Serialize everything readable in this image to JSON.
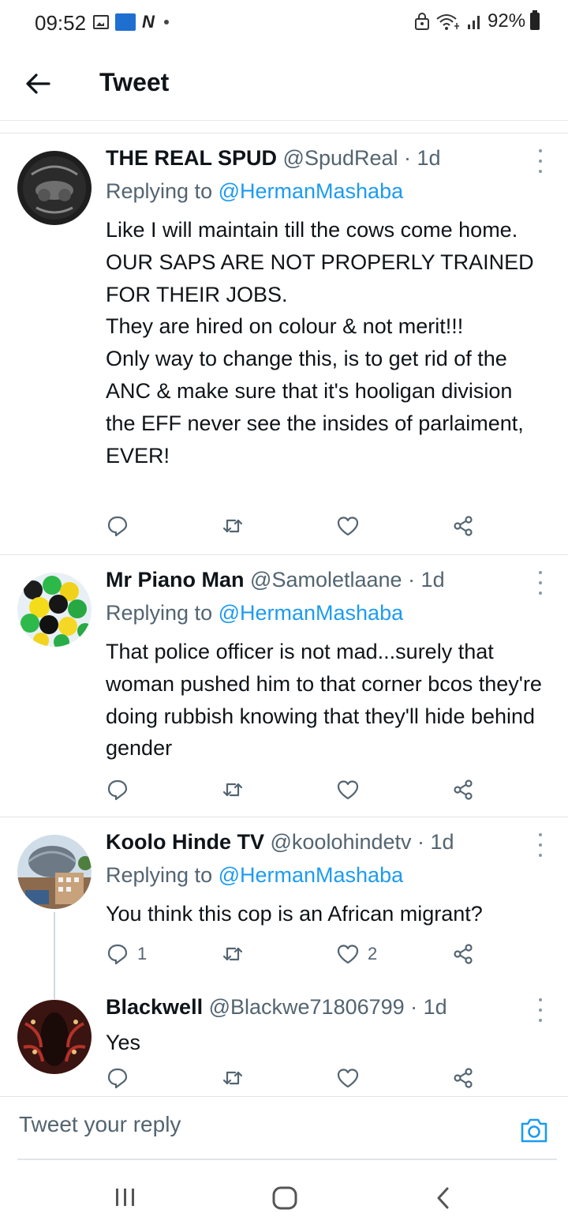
{
  "status_bar": {
    "time": "09:52",
    "battery": "92%"
  },
  "header": {
    "title": "Tweet"
  },
  "tweets": [
    {
      "name": "THE REAL SPUD",
      "handle": "@SpudReal",
      "time": " · 1d",
      "replying_prefix": "Replying to ",
      "replying_to": "@HermanMashaba",
      "text": "Like I will maintain till the cows come home.\nOUR SAPS ARE NOT PROPERLY TRAINED FOR THEIR JOBS.\nThey are hired on colour & not merit!!!\nOnly way to change this, is to get rid of the ANC & make sure that it's hooligan division the EFF never see the insides of parlaiment, EVER!",
      "replies": "",
      "retweets": "",
      "likes": ""
    },
    {
      "name": "Mr Piano Man",
      "handle": "@Samoletlaane",
      "time": " · 1d",
      "replying_prefix": "Replying to ",
      "replying_to": "@HermanMashaba",
      "text": "That police officer is not mad...surely that woman pushed him to that corner bcos they're doing rubbish knowing that they'll hide behind gender",
      "replies": "",
      "retweets": "",
      "likes": ""
    },
    {
      "name": "Koolo Hinde TV",
      "handle": "@koolohindetv",
      "time": " · 1d",
      "replying_prefix": "Replying to ",
      "replying_to": "@HermanMashaba",
      "text": "You think this cop is an African migrant?",
      "replies": "1",
      "retweets": "",
      "likes": "2"
    },
    {
      "name": "Blackwell",
      "handle": "@Blackwe71806799",
      "time": " · 1d",
      "text": "Yes",
      "replies": "",
      "retweets": "",
      "likes": ""
    }
  ],
  "reply_bar": {
    "placeholder": "Tweet your reply"
  },
  "icons": {
    "back": "arrow-left-icon",
    "reply": "comment-icon",
    "retweet": "retweet-icon",
    "like": "heart-icon",
    "share": "share-icon",
    "camera": "camera-icon"
  },
  "colors": {
    "accent": "#1d9bf0",
    "secondary_text": "#536471"
  }
}
